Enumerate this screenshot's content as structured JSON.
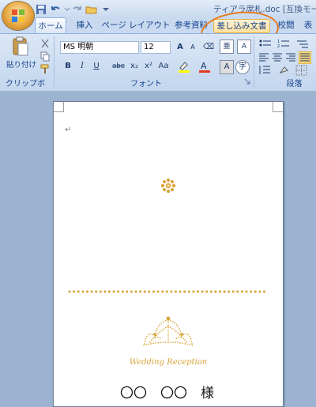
{
  "window": {
    "title": "ティアラ席札.doc [互換モード]"
  },
  "quick_access": {
    "icons": [
      "save-icon",
      "undo-icon",
      "redo-icon",
      "open-icon",
      "customize-icon"
    ]
  },
  "tabs": [
    {
      "id": "home",
      "label": "ホーム",
      "active": true
    },
    {
      "id": "insert",
      "label": "挿入"
    },
    {
      "id": "layout",
      "label": "ページ レイアウト"
    },
    {
      "id": "references",
      "label": "参考資料"
    },
    {
      "id": "mailings",
      "label": "差し込み文書",
      "highlighted": true
    },
    {
      "id": "review",
      "label": "校閲"
    },
    {
      "id": "view",
      "label": "表"
    }
  ],
  "clipboard": {
    "paste_label": "貼り付け",
    "group_label": "クリップボード"
  },
  "font": {
    "name": "MS 明朝",
    "size": "12",
    "group_label": "フォント",
    "buttons": [
      "B",
      "I",
      "U",
      "abe",
      "x₂",
      "x²",
      "Aa"
    ]
  },
  "paragraph": {
    "group_label": "段落"
  },
  "document": {
    "para_mark": "↵",
    "caption": "Wedding Reception",
    "guest_name": "〇〇　〇〇　様",
    "accent_color": "#d9a43a"
  },
  "colors": {
    "highlight_ring": "#e57a20",
    "ribbon_text": "#15428b"
  }
}
